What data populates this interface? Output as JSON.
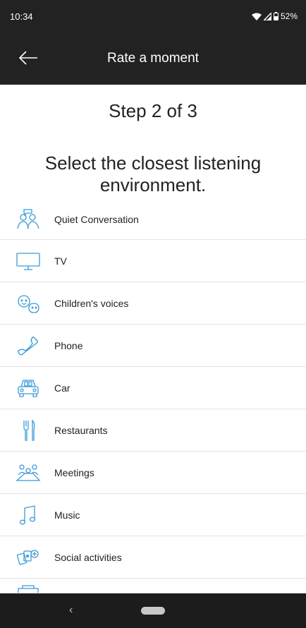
{
  "status_bar": {
    "time": "10:34",
    "battery": "52%"
  },
  "app_bar": {
    "title": "Rate a moment",
    "back_icon": "arrow-left-icon"
  },
  "step_text": "Step 2 of 3",
  "instruction": "Select the closest listening environment.",
  "environments": [
    {
      "label": "Quiet Conversation",
      "icon": "quiet-conversation-icon"
    },
    {
      "label": "TV",
      "icon": "tv-icon"
    },
    {
      "label": "Children's voices",
      "icon": "childrens-voices-icon"
    },
    {
      "label": "Phone",
      "icon": "phone-icon"
    },
    {
      "label": "Car",
      "icon": "car-icon"
    },
    {
      "label": "Restaurants",
      "icon": "restaurant-icon"
    },
    {
      "label": "Meetings",
      "icon": "meetings-icon"
    },
    {
      "label": "Music",
      "icon": "music-icon"
    },
    {
      "label": "Social activities",
      "icon": "social-activities-icon"
    }
  ],
  "colors": {
    "accent": "#3a9bd8",
    "bar": "#222222"
  },
  "nav_bar": {
    "back_glyph": "‹"
  }
}
